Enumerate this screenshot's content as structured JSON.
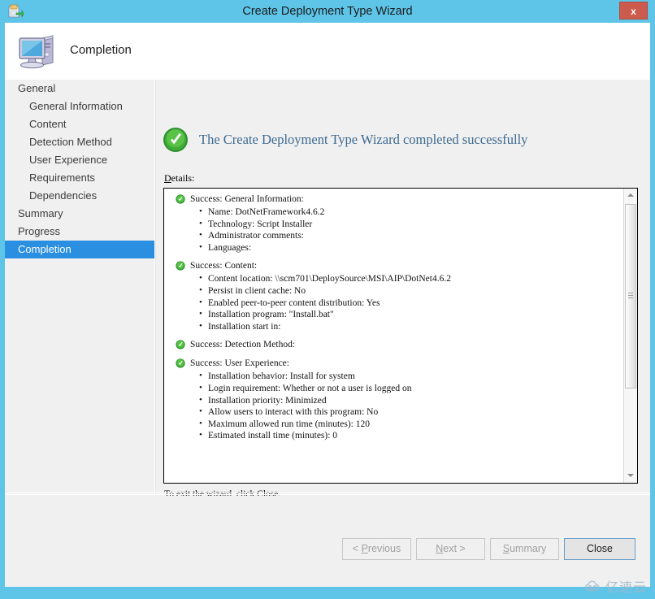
{
  "window": {
    "title": "Create Deployment Type Wizard",
    "icon": "deployment-type-icon",
    "close_label": "x",
    "frame_color": "#5ec5e8"
  },
  "header": {
    "title": "Completion",
    "icon": "computer-icon"
  },
  "sidebar": {
    "items": [
      {
        "label": "General",
        "level": 0,
        "selected": false
      },
      {
        "label": "General Information",
        "level": 1,
        "selected": false
      },
      {
        "label": "Content",
        "level": 1,
        "selected": false
      },
      {
        "label": "Detection Method",
        "level": 1,
        "selected": false
      },
      {
        "label": "User Experience",
        "level": 1,
        "selected": false
      },
      {
        "label": "Requirements",
        "level": 1,
        "selected": false
      },
      {
        "label": "Dependencies",
        "level": 1,
        "selected": false
      },
      {
        "label": "Summary",
        "level": 0,
        "selected": false
      },
      {
        "label": "Progress",
        "level": 0,
        "selected": false
      },
      {
        "label": "Completion",
        "level": 0,
        "selected": true
      }
    ],
    "selected_color": "#2a8fe0"
  },
  "content": {
    "result_icon": "success-check-icon",
    "result_text": "The Create Deployment Type Wizard completed successfully",
    "result_text_color": "#3d6a91",
    "details_label": "Details:",
    "details_label_accel": "D",
    "details_label_rest": "etails:",
    "exit_text": "To exit the wizard, click Close.",
    "sections": [
      {
        "icon": "success-check-icon",
        "heading": "Success: General Information:",
        "items": [
          "Name: DotNetFramework4.6.2",
          "Technology: Script Installer",
          "Administrator comments:",
          "Languages:"
        ]
      },
      {
        "icon": "success-check-icon",
        "heading": "Success: Content:",
        "items": [
          "Content location: \\\\scm701\\DeploySource\\MSI\\AIP\\DotNet4.6.2",
          "Persist in client cache: No",
          "Enabled peer-to-peer content distribution: Yes",
          "Installation program: \"Install.bat\"",
          "Installation start in:"
        ]
      },
      {
        "icon": "success-check-icon",
        "heading": "Success: Detection Method:",
        "items": []
      },
      {
        "icon": "success-check-icon",
        "heading": "Success: User Experience:",
        "items": [
          "Installation behavior: Install for system",
          "Login requirement: Whether or not a user is logged on",
          "Installation priority: Minimized",
          "Allow users to interact with this program: No",
          "Maximum allowed run time (minutes): 120",
          "Estimated install time (minutes): 0"
        ]
      }
    ],
    "scrollbar": {
      "up_icon": "caret-up-icon",
      "down_icon": "caret-down-icon",
      "thumb_position_percent": 0,
      "thumb_size_percent": 63
    }
  },
  "buttons": {
    "previous": {
      "accel": "P",
      "before": "< ",
      "after": "revious",
      "enabled": false
    },
    "next": {
      "accel": "N",
      "before": "",
      "after": "ext >",
      "enabled": false
    },
    "summary": {
      "accel": "S",
      "before": "",
      "after": "ummary",
      "enabled": false
    },
    "close": {
      "accel": "",
      "before": "Close",
      "after": "",
      "enabled": true
    }
  },
  "watermark": {
    "text": "亿速云",
    "icon": "cloud-icon"
  }
}
